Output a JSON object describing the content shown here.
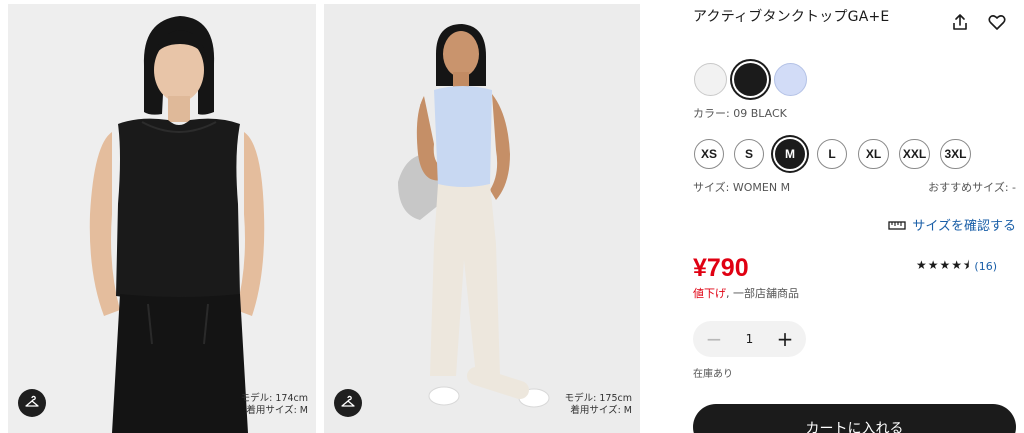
{
  "gallery": {
    "photos": [
      {
        "model_info_line1": "モデル: 174cm",
        "model_info_line2": "着用サイズ: M",
        "try_on_icon": "hanger-icon"
      },
      {
        "model_info_line1": "モデル: 175cm",
        "model_info_line2": "着用サイズ: M",
        "try_on_icon": "hanger-icon"
      }
    ]
  },
  "product": {
    "title": "アクティブタンクトップGA+E",
    "share_icon": "share-icon",
    "favorite_icon": "heart-icon",
    "colors": [
      {
        "name": "white",
        "hex": "#f2f2f2"
      },
      {
        "name": "black",
        "hex": "#1b1b1b"
      },
      {
        "name": "light-blue",
        "hex": "#d2dcf7"
      }
    ],
    "selected_color_label": "カラー: 09 BLACK",
    "sizes": [
      "XS",
      "S",
      "M",
      "L",
      "XL",
      "XXL",
      "3XL"
    ],
    "selected_size": "M",
    "selected_size_label": "サイズ: WOMEN M",
    "recommended_size_label": "おすすめサイズ: -",
    "size_guide": {
      "label": "サイズを確認する",
      "icon": "ruler-icon"
    },
    "price": "¥790",
    "rating": {
      "stars": "★★★★⯨",
      "value": 4.5,
      "reviews": "(16)"
    },
    "sale_tag": "値下げ",
    "sale_separator": ",",
    "sale_note": "一部店舗商品",
    "quantity": {
      "value": "1",
      "minus": "−",
      "plus": "+"
    },
    "stock_status": "在庫あり",
    "add_to_cart": "カートに入れる"
  },
  "colors": {
    "price_red": "#e00012",
    "link_blue": "#1a5fa8",
    "dark": "#1b1b1b"
  }
}
